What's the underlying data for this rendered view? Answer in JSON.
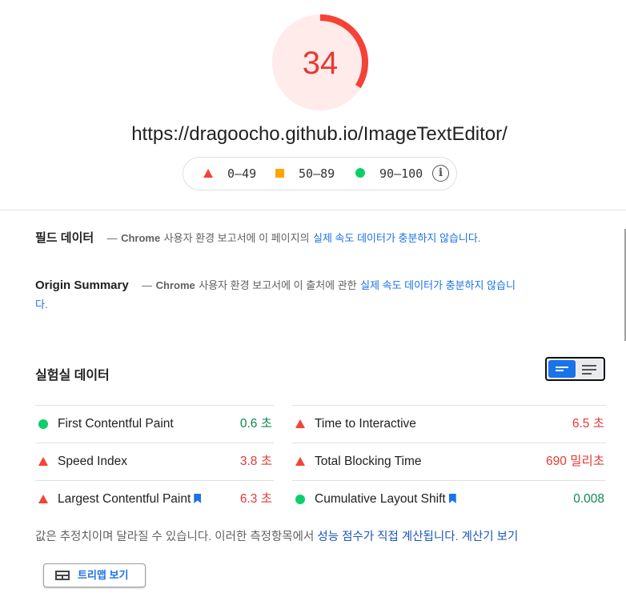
{
  "score": {
    "value": "34",
    "fraction": 0.34,
    "color": "#e53935"
  },
  "url": "https://dragoocho.github.io/ImageTextEditor/",
  "legend": {
    "fail": "0–49",
    "average": "50–89",
    "pass": "90–100",
    "info_icon": "info-icon"
  },
  "field": {
    "title": "필드 데이터",
    "dash": "—",
    "source": "Chrome",
    "text": "사용자 환경 보고서에 이 페이지의",
    "link": "실제 속도 데이터가 충분하지 않습니다",
    "end": "."
  },
  "origin": {
    "title": "Origin Summary",
    "dash": "—",
    "source": "Chrome",
    "text": "사용자 환경 보고서에 이 출처에 관한",
    "link": "실제 속도 데이터가 충분하지 않습니",
    "link2": "다",
    "end": "."
  },
  "lab": {
    "title": "실험실 데이터"
  },
  "metrics_left": [
    {
      "name": "First Contentful Paint",
      "value": "0.6 초",
      "status": "pass"
    },
    {
      "name": "Speed Index",
      "value": "3.8 초",
      "status": "fail"
    },
    {
      "name": "Largest Contentful Paint",
      "value": "6.3 초",
      "status": "fail",
      "bookmark": true
    }
  ],
  "metrics_right": [
    {
      "name": "Time to Interactive",
      "value": "6.5 초",
      "status": "fail"
    },
    {
      "name": "Total Blocking Time",
      "value": "690 밀리초",
      "status": "fail"
    },
    {
      "name": "Cumulative Layout Shift",
      "value": "0.008",
      "status": "pass",
      "bookmark": true
    }
  ],
  "note": {
    "text": "값은 추정치이며 달라질 수 있습니다. 이러한 측정항목에서",
    "link1": "성능 점수가 직접 계산됩니다",
    "sep": ".",
    "link2": "계산기 보기"
  },
  "treemap": {
    "label": "트리맵 보기"
  },
  "colors": {
    "fail": "#e53935",
    "pass": "#0c8a4d",
    "average": "#ffa400",
    "link": "#1a73e8"
  }
}
